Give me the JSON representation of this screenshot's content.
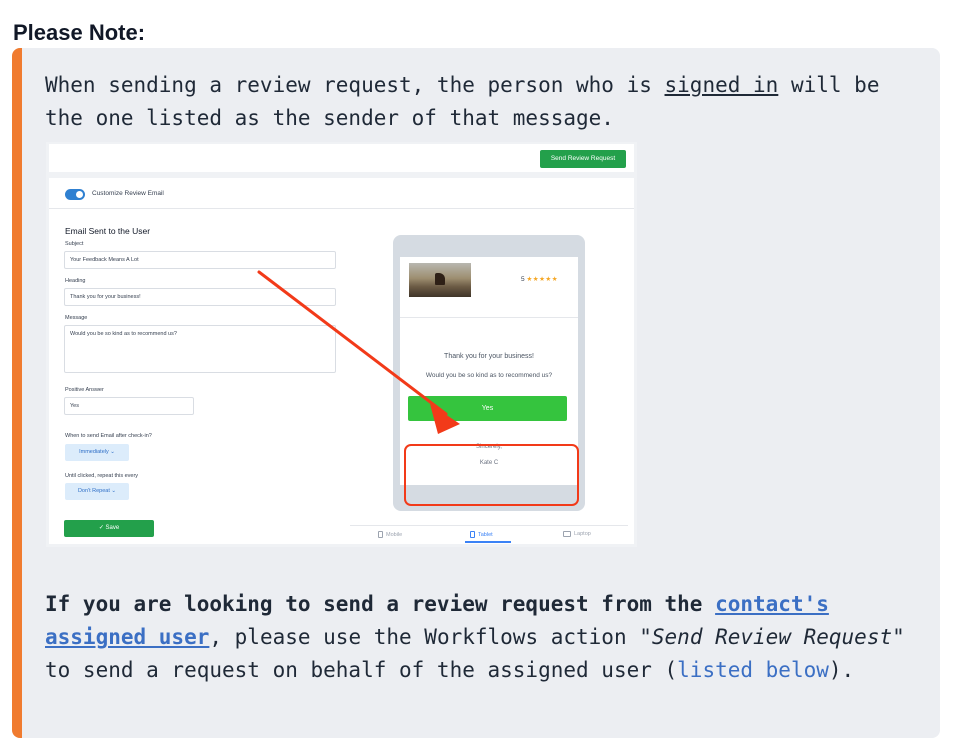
{
  "note_title": "Please Note:",
  "para1": {
    "part1": "When sending a review request, the person who is ",
    "signed_in": "signed in",
    "part2": " will be the one listed as the sender of that message."
  },
  "screenshot": {
    "send_button": "Send Review Request",
    "customize_label": "Customize Review Email",
    "customize_enabled": true,
    "form_title": "Email Sent to the User",
    "subject_label": "Subject",
    "subject_value": "Your Feedback Means A Lot",
    "heading_label": "Heading",
    "heading_value": "Thank you for your business!",
    "message_label": "Message",
    "message_value": "Would you be so kind as to recommend us?",
    "positive_label": "Positive Answer",
    "positive_value": "Yes",
    "when_label": "When to send Email after check-in?",
    "when_value": "Immediately",
    "repeat_label": "Until clicked, repeat this every",
    "repeat_value": "Don't Repeat",
    "save_label": "✓ Save",
    "preview": {
      "rating_value": "5",
      "stars": "★★★★★",
      "heading": "Thank you for your business!",
      "message": "Would you be so kind as to recommend us?",
      "yes_button": "Yes",
      "sincerely": "Sincerely,",
      "sender": "Kate C"
    },
    "device_tabs": [
      "Mobile",
      "Tablet",
      "Laptop"
    ],
    "active_device": "Tablet",
    "highlight_color": "#f23a19"
  },
  "para2": {
    "bold_lead": "If you are looking to send a review request from the ",
    "link_bold": "contact's assigned user",
    "part1": ", please use the Workflows action \"",
    "italic": "Send Review Request",
    "part2": "\" to send a request on behalf of the assigned user (",
    "link": "listed below",
    "part3": ")."
  },
  "colors": {
    "accent_bar": "#f07b2f",
    "link": "#3b6fc4",
    "callout_bg": "#eceef2"
  }
}
